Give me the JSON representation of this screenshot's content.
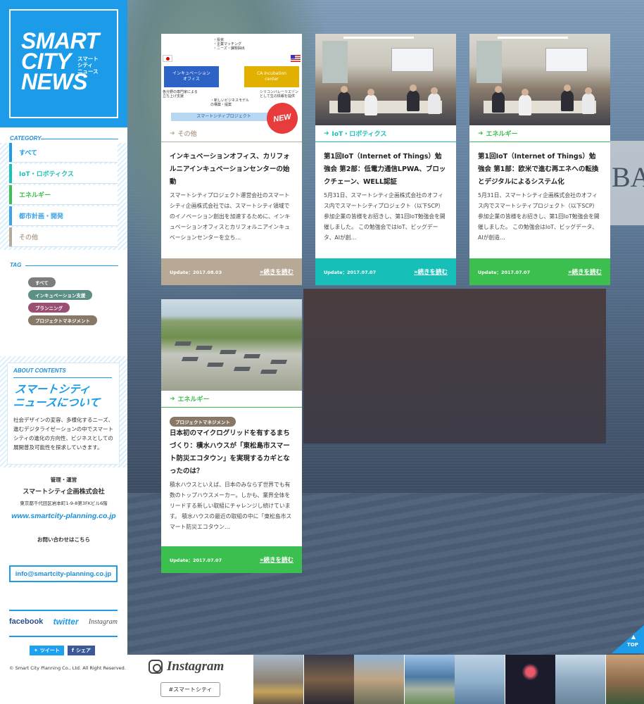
{
  "brand": {
    "logo_lines": [
      "SMART",
      "CITY",
      "NEWS"
    ],
    "logo_sub": [
      "スマート",
      "シティ",
      "ニュース"
    ],
    "colors": {
      "primary": "#1b9be8"
    }
  },
  "sidebar": {
    "category_label": "CATEGORY",
    "categories": [
      {
        "label": "すべて",
        "color": "#1b9be8"
      },
      {
        "label": "IoT・ロボティクス",
        "color": "#16c0b8"
      },
      {
        "label": "エネルギー",
        "color": "#3bbf4e"
      },
      {
        "label": "都市計画・開発",
        "color": "#3aa2e6"
      },
      {
        "label": "その他",
        "color": "#b8a896"
      }
    ],
    "tag_label": "TAG",
    "tags": [
      {
        "label": "すべて",
        "color": "#7d7d7d"
      },
      {
        "label": "インキュベーション支援",
        "color": "#5c8f86"
      },
      {
        "label": "ブランニング",
        "color": "#9a4f73"
      },
      {
        "label": "プロジェクトマネジメント",
        "color": "#877867"
      }
    ],
    "about": {
      "label": "ABOUT CONTENTS",
      "title_1": "スマートシティ",
      "title_2": "ニュースについて",
      "text": "社会デザインの変容、多様化するニーズ、進むデジタライゼーションの中でスマートシティの進化の方向性、ビジネスとしての展開普及可能性を探求していきます。"
    },
    "company": {
      "role": "管理・運営",
      "name": "スマートシティ企画株式会社",
      "address": "東京都千代田区岩本町1-9-8第3FKビル6階",
      "url": "www.smartcity-planning.co.jp",
      "contact_label": "お問い合わせはこちら",
      "email": "info@smartcity-planning.co.jp"
    },
    "social": {
      "facebook": "facebook",
      "twitter": "twitter",
      "instagram": "Instagram"
    },
    "share": {
      "tweet": "ツイート",
      "facebook_share": "シェア"
    },
    "copyright": "© Smart City Planning Co., Ltd. All Right Reserved."
  },
  "cards": [
    {
      "category": "その他",
      "category_color": "#b8a896",
      "title": "インキュベーションオフィス、カリフォルニアインキュベーションセンターの始動",
      "excerpt": "スマートシティプロジェクト運営会社のスマートシティ企画株式会社では、スマートシティ領域でのイノベーション創出を加速するために、インキュベーションオフィスとカリフォルニアインキュベーションセンターを立ち…",
      "update": "Update：2017.08.03",
      "more": "»続きを読む",
      "footer_color": "#b8a896",
      "badge": "NEW",
      "diagram": {
        "box_left": "インキュベーション\nオフィス",
        "box_right": "CA Incubation\ncenter",
        "top_note": "・投資\n・企業マッチング\n・ニーズ・課題抽出",
        "left_note": "各分野の専門家による\n立ち上げ支援",
        "right_note": "シリコンバレーリエゾン\nとして生の情報を提供",
        "bottom_note": "・新しいビジネスモデル\nの構築・提案",
        "band": "スマートシティプロジェクト"
      }
    },
    {
      "category": "IoT・ロボティクス",
      "category_color": "#16c0b8",
      "title": "第1回IoT（Internet of Things）勉強会 第2部：低電力通信LPWA、ブロックチェーン、WELL認証",
      "excerpt": "5月31日、スマートシティ企画株式会社のオフィス内でスマートシティプロジェクト（以下SCP）参加企業の皆様をお招きし、第1回IoT勉強会を開催しました。 この勉強会ではIoT、ビッグデータ、AIが創…",
      "update": "Update：2017.07.07",
      "more": "»続きを読む",
      "footer_color": "#16c0b8"
    },
    {
      "category": "エネルギー",
      "category_color": "#3bbf4e",
      "title": "第1回IoT（Internet of Things）勉強会 第1部：欧米で進む再エネへの転換とデジタルによるシステム化",
      "excerpt": "5月31日、スマートシティ企画株式会社のオフィス内でスマートシティプロジェクト（以下SCP）参加企業の皆様をお招きし、第1回IoT勉強会を開催しました。 この勉強会はIoT、ビッグデータ、AIが創造…",
      "update": "Update：2017.07.07",
      "more": "»続きを読む",
      "footer_color": "#3bbf4e"
    },
    {
      "category": "エネルギー",
      "category_color": "#3bbf4e",
      "tag": "プロジェクトマネジメント",
      "title": "日本初のマイクログリッドを有するまちづくり：積水ハウスが「東松島市スマート防災エコタウン」を実現するカギとなったのは？",
      "excerpt": "積水ハウスといえば、日本のみならず世界でも有数のトップハウスメーカー。しかも、業界全体をリードする新しい取組にチャレンジし続けています。 積水ハウスの最近の取組の中に「東松島市スマート防災エコタウン…",
      "update": "Update：2017.07.07",
      "more": "»続きを読む",
      "footer_color": "#3bbf4e"
    }
  ],
  "instagram": {
    "word": "Instagram",
    "hashtag": "#スマートシティ"
  },
  "top_button": "TOP"
}
